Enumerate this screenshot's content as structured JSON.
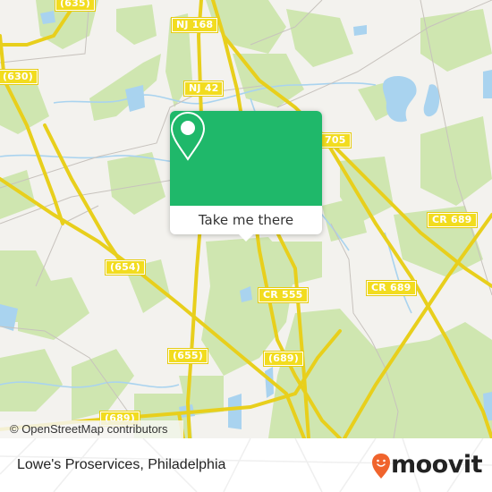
{
  "map": {
    "colors": {
      "background": "#f3f2ee",
      "forest": "#cfe6b0",
      "water": "#a9d3ef",
      "road_major": "#f2dc1f",
      "road_minor": "#c7c2bd",
      "accent": "#1fb86a",
      "brand": "#f0642d"
    },
    "road_labels": [
      {
        "id": "cr635",
        "text": "(635)"
      },
      {
        "id": "nj168",
        "text": "NJ 168"
      },
      {
        "id": "cr630",
        "text": "(630)"
      },
      {
        "id": "nj42",
        "text": "NJ 42"
      },
      {
        "id": "cr705",
        "text": "705"
      },
      {
        "id": "cr654",
        "text": "(654)"
      },
      {
        "id": "cr689a",
        "text": "CR 689"
      },
      {
        "id": "cr555",
        "text": "CR 555"
      },
      {
        "id": "cr689b",
        "text": "CR 689"
      },
      {
        "id": "cr655",
        "text": "(655)"
      },
      {
        "id": "cr689c",
        "text": "(689)"
      },
      {
        "id": "cr689d",
        "text": "(689)"
      }
    ],
    "attribution": "© OpenStreetMap contributors"
  },
  "popup": {
    "icon": "location-pin-icon",
    "button_label": "Take me there"
  },
  "footer": {
    "place_title": "Lowe's Proservices, Philadelphia",
    "brand": "moovit",
    "brand_icon": "moovit-smiley-pin-icon"
  }
}
